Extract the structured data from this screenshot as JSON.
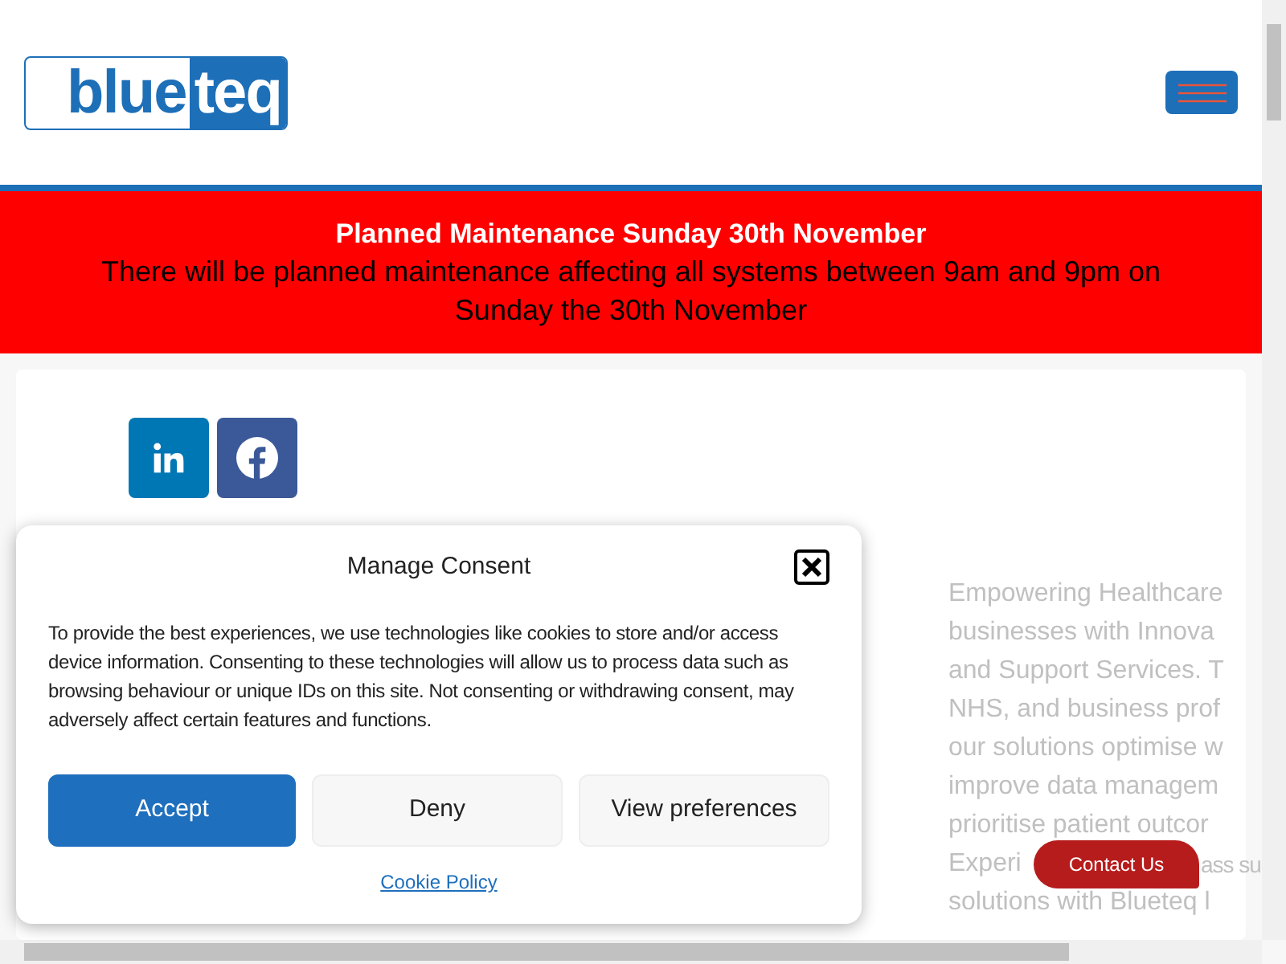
{
  "header": {
    "logo": {
      "left": "blue",
      "right": "teq"
    },
    "menu_button": {
      "expanded": false
    }
  },
  "banner": {
    "title": "Planned Maintenance Sunday 30th November",
    "message": "There will be planned maintenance affecting all systems between 9am and 9pm on Sunday the 30th November"
  },
  "social_links": [
    {
      "kind": "linkedin"
    },
    {
      "kind": "facebook"
    }
  ],
  "intro_lines": [
    {
      "text": "Empowering Healthcare"
    },
    {
      "text": "businesses with Innova"
    },
    {
      "text": "and Support Services. T"
    },
    {
      "text": "NHS, and business prof"
    },
    {
      "text": "our solutions optimise w"
    },
    {
      "text": "improve data managem"
    },
    {
      "text": "prioritise patient outcor"
    },
    {
      "text": "Experi",
      "text_after": "ass su"
    },
    {
      "text": "solutions with Blueteq l"
    }
  ],
  "consent_dialog": {
    "title": "Manage Consent",
    "body": "To provide the best experiences, we use technologies like cookies to store and/or access device information. Consenting to these technologies will allow us to process data such as browsing behaviour or unique IDs on this site. Not consenting or withdrawing consent, may adversely affect certain features and functions.",
    "buttons": [
      {
        "label": "Accept",
        "kind": "primary"
      },
      {
        "label": "Deny",
        "kind": "secondary"
      },
      {
        "label": "View preferences",
        "kind": "secondary"
      }
    ],
    "link": "Cookie Policy"
  },
  "contact_button": "Contact Us"
}
